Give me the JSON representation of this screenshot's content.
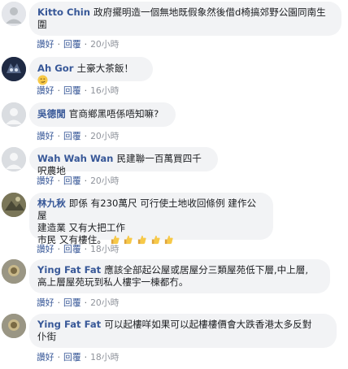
{
  "ui": {
    "like": "讚好",
    "reply": "回覆",
    "dot": "·"
  },
  "comments": [
    {
      "author": "Kitto Chin",
      "text": "政府擺明造一個無地既假象然後借d椅搞郊野公園同南生圍",
      "time": "20小時"
    },
    {
      "author": "Ah Gor",
      "text": "土豪大茶飯！",
      "emoji": "smirk-face-icon",
      "time": "16小時"
    },
    {
      "author": "吳德閒",
      "text": "官商鄉黑唔係唔知嘛?",
      "time": "20小時"
    },
    {
      "author": "Wah Wah Wan",
      "text": "民建聯一百萬買四千呎農地",
      "time": "20小時"
    },
    {
      "author": "林九秋",
      "text_lines": [
        "即係 有230萬尺 可行使土地收回條例 建作公屋",
        "建造業 又有大把工作",
        "市民 又有樓住。"
      ],
      "emoji": "thumbs-up-icons",
      "emoji_count": 5,
      "time": "18小時"
    },
    {
      "author": "Ying Fat Fat",
      "text_lines": [
        "應該全部起公屋或居屋分三類屋苑低下層,中上層,",
        "高上層屋苑玩到私人樓宇一棟都冇。"
      ],
      "time": "20小時"
    },
    {
      "author": "Ying Fat Fat",
      "text_lines": [
        "可以起樓咩如果可以起樓樓價會大跌香港太多反對",
        "仆街"
      ],
      "time": "18小時"
    }
  ],
  "colors": {
    "name": "#385898",
    "bubble": "#f2f3f5",
    "meta": "#90949c"
  }
}
